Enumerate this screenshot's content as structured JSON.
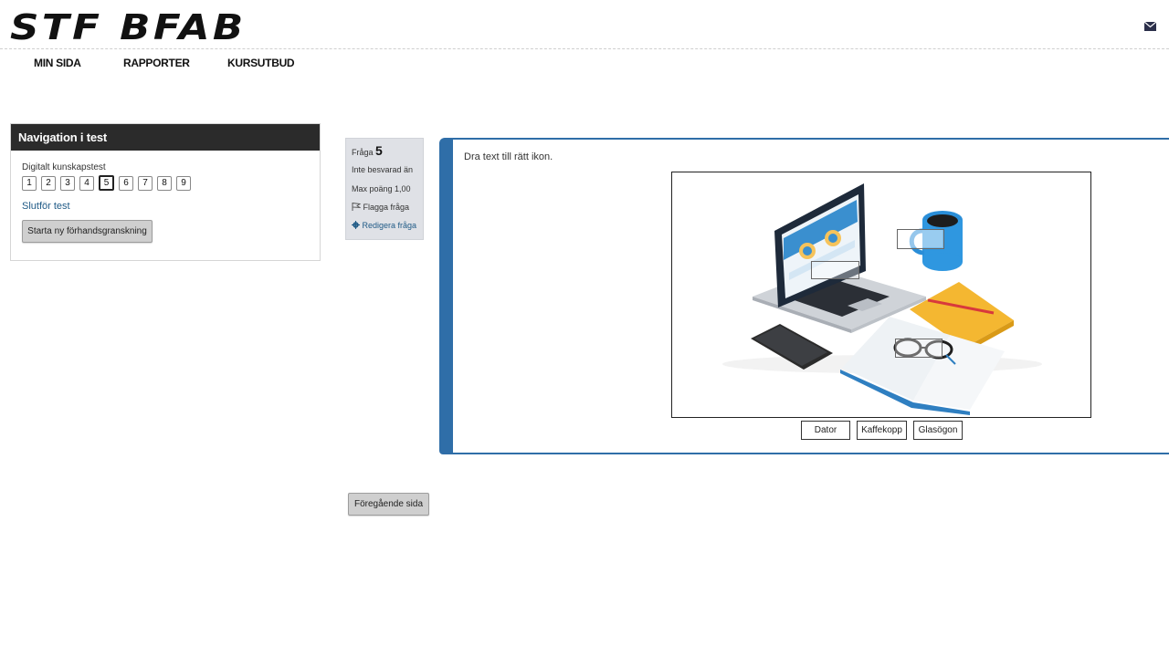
{
  "header": {
    "logo_text": "STF BFAB",
    "mail_icon": "envelope-icon"
  },
  "main_nav": [
    "MIN SIDA",
    "RAPPORTER",
    "KURSUTBUD"
  ],
  "quiz_navigation": {
    "title": "Navigation i test",
    "quiz_name": "Digitalt kunskapstest",
    "questions": [
      "1",
      "2",
      "3",
      "4",
      "5",
      "6",
      "7",
      "8",
      "9"
    ],
    "current_question": "5",
    "finish_link": "Slutför test",
    "new_preview_button": "Starta ny förhandsgranskning"
  },
  "question_info": {
    "label": "Fråga",
    "number": "5",
    "status": "Inte besvarad än",
    "max_points": "Max poäng 1,00",
    "flag_label": "Flagga fråga",
    "edit_label": "Redigera fråga"
  },
  "question": {
    "text": "Dra text till rätt ikon.",
    "drag_items": [
      "Dator",
      "Kaffekopp",
      "Glasögon"
    ]
  },
  "footer": {
    "previous_page_button": "Föregående sida"
  },
  "colors": {
    "accent": "#2f6ea8",
    "nav_header_bg": "#2b2b2b",
    "info_bg": "#dfe1e6",
    "link": "#1f5a86"
  }
}
